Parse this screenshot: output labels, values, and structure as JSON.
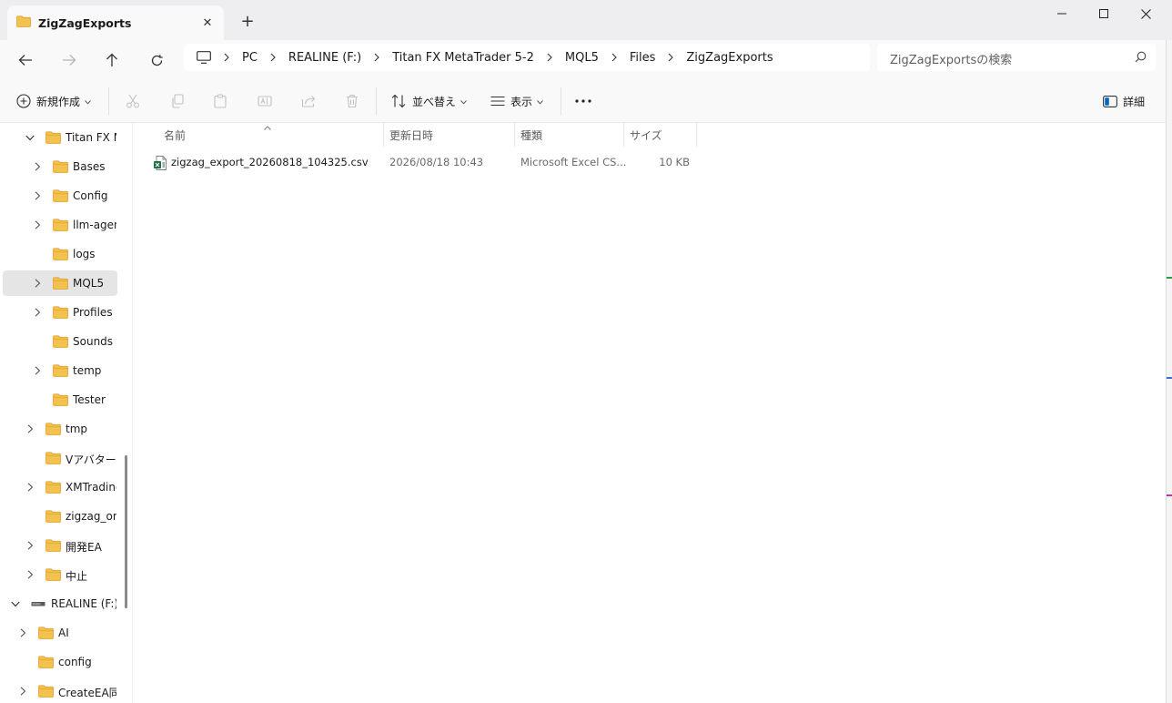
{
  "window": {
    "tab_title": "ZigZagExports",
    "new_tab": "+",
    "tab_close": "✕"
  },
  "address": {
    "crumbs": [
      "PC",
      "REALINE (F:)",
      "Titan FX MetaTrader 5-2",
      "MQL5",
      "Files",
      "ZigZagExports"
    ]
  },
  "search": {
    "placeholder": "ZigZagExportsの検索"
  },
  "toolbar": {
    "new_label": "新規作成",
    "sort_label": "並べ替え",
    "view_label": "表示",
    "details_label": "詳細"
  },
  "sidebar": {
    "items": [
      {
        "label": "Titan FX M",
        "level": 1,
        "expander": "expanded"
      },
      {
        "label": "Bases",
        "level": 2,
        "expander": "collapsed"
      },
      {
        "label": "Config",
        "level": 2,
        "expander": "collapsed"
      },
      {
        "label": "llm-agent",
        "level": 2,
        "expander": "collapsed"
      },
      {
        "label": "logs",
        "level": 2,
        "expander": "none"
      },
      {
        "label": "MQL5",
        "level": 2,
        "expander": "collapsed",
        "selected": true
      },
      {
        "label": "Profiles",
        "level": 2,
        "expander": "collapsed"
      },
      {
        "label": "Sounds",
        "level": 2,
        "expander": "none"
      },
      {
        "label": "temp",
        "level": 2,
        "expander": "collapsed"
      },
      {
        "label": "Tester",
        "level": 2,
        "expander": "none"
      },
      {
        "label": "tmp",
        "level": 1,
        "expander": "collapsed"
      },
      {
        "label": "Vアバター",
        "level": 1,
        "expander": "none"
      },
      {
        "label": "XMTrading",
        "level": 1,
        "expander": "collapsed"
      },
      {
        "label": "zigzag_orig",
        "level": 1,
        "expander": "none"
      },
      {
        "label": "開発EA",
        "level": 1,
        "expander": "collapsed"
      },
      {
        "label": "中止",
        "level": 1,
        "expander": "collapsed"
      },
      {
        "label": "REALINE (F:)",
        "level": 0,
        "expander": "expanded",
        "drive": true
      },
      {
        "label": "AI",
        "level": 0.5,
        "expander": "collapsed"
      },
      {
        "label": "config",
        "level": 0.5,
        "expander": "none"
      },
      {
        "label": "CreateEA同期",
        "level": 0.5,
        "expander": "collapsed"
      }
    ]
  },
  "columns": {
    "name": "名前",
    "modified": "更新日時",
    "type": "種類",
    "size": "サイズ"
  },
  "files": [
    {
      "name": "zigzag_export_20260818_104325.csv",
      "modified": "2026/08/18 10:43",
      "type": "Microsoft Excel CS...",
      "size": "10 KB"
    }
  ],
  "colors": {
    "folder": "#f2c14e",
    "folder_dark": "#dca234",
    "excel": "#1d7044",
    "accent": "#0067c0"
  }
}
